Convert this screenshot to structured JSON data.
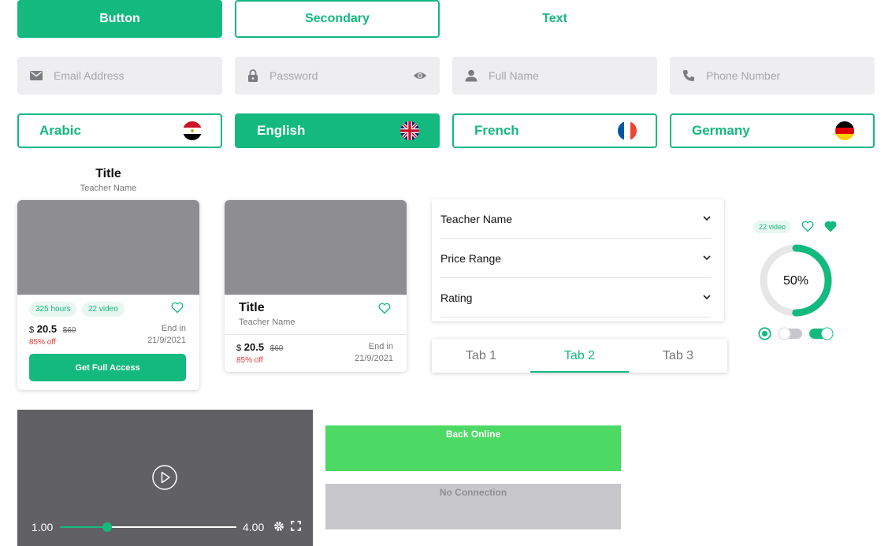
{
  "buttons": {
    "primary": "Button",
    "secondary": "Secondary",
    "text": "Text"
  },
  "inputs": {
    "email_placeholder": "Email Address",
    "password_placeholder": "Password",
    "fullname_placeholder": "Full Name",
    "phone_placeholder": "Phone Number"
  },
  "languages": [
    {
      "label": "Arabic",
      "flag": "egypt-flag-icon",
      "selected": false
    },
    {
      "label": "English",
      "flag": "uk-flag-icon",
      "selected": true
    },
    {
      "label": "French",
      "flag": "france-flag-icon",
      "selected": false
    },
    {
      "label": "Germany",
      "flag": "germany-flag-icon",
      "selected": false
    }
  ],
  "card1": {
    "title": "Title",
    "teacher": "Teacher Name",
    "hours": "325 hours",
    "videos": "22 video",
    "currency": "$",
    "price": "20.5",
    "old_price": "$60",
    "discount": "85% off",
    "end_label": "End in",
    "end_date": "21/9/2021",
    "cta": "Get Full Access"
  },
  "card2": {
    "title": "Title",
    "teacher": "Teacher Name",
    "currency": "$",
    "price": "20.5",
    "old_price": "$60",
    "discount": "85% off",
    "end_label": "End in",
    "end_date": "21/9/2021"
  },
  "filters": [
    {
      "label": "Teacher Name"
    },
    {
      "label": "Price Range"
    },
    {
      "label": "Rating"
    }
  ],
  "tabs": [
    {
      "label": "Tab 1",
      "active": false
    },
    {
      "label": "Tab 2",
      "active": true
    },
    {
      "label": "Tab 3",
      "active": false
    }
  ],
  "progress_widget": {
    "videos": "22 video",
    "percent_label": "50%",
    "progress": 0.5
  },
  "video_player": {
    "current": "1.00",
    "total": "4.00",
    "progress": 0.27
  },
  "banners": {
    "online": "Back Online",
    "offline": "No Connection"
  },
  "colors": {
    "accent": "#14b97e",
    "online": "#4cd964",
    "offline": "#c8c7cc",
    "thumb": "#8e8d92",
    "video_bg": "#616064",
    "discount": "#e53935"
  }
}
